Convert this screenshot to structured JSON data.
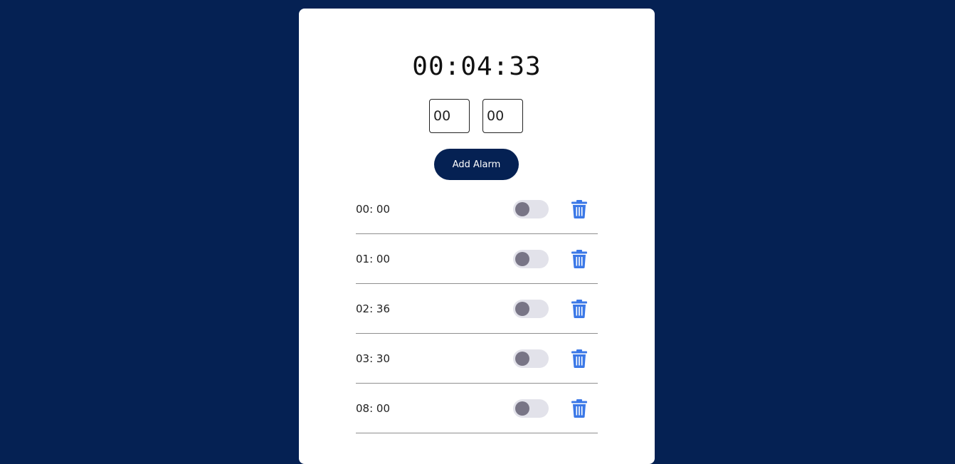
{
  "clock": {
    "time": "00:04:33"
  },
  "inputs": {
    "hour_value": "00",
    "minute_value": "00"
  },
  "add_button": {
    "label": "Add Alarm"
  },
  "alarms": [
    {
      "time": "00: 00",
      "enabled": false
    },
    {
      "time": "01: 00",
      "enabled": false
    },
    {
      "time": "02: 36",
      "enabled": false
    },
    {
      "time": "03: 30",
      "enabled": false
    },
    {
      "time": "08: 00",
      "enabled": false
    }
  ],
  "icons": {
    "delete": "trash-icon"
  },
  "colors": {
    "background": "#052153",
    "card": "#ffffff",
    "button": "#052153",
    "trash": "#3b78e7",
    "toggle_track": "#e2e2ea",
    "toggle_knob": "#787586"
  }
}
